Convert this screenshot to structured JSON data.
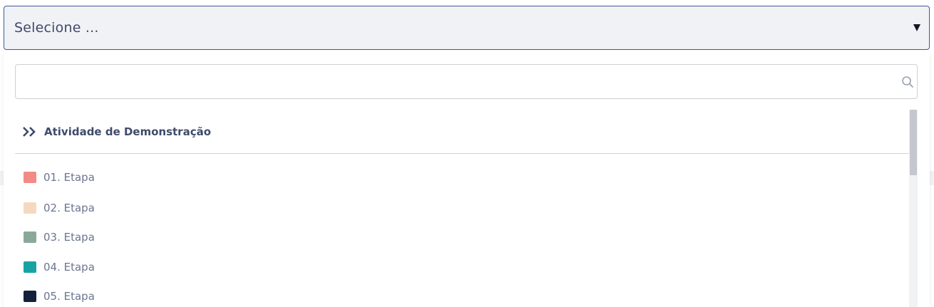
{
  "select": {
    "placeholder": "Selecione ..."
  },
  "search": {
    "value": "",
    "placeholder": ""
  },
  "group": {
    "label": "Atividade de Demonstração"
  },
  "options": [
    {
      "label": "01. Etapa",
      "color": "#f28b86"
    },
    {
      "label": "02. Etapa",
      "color": "#f5d9bf"
    },
    {
      "label": "03. Etapa",
      "color": "#8aa99a"
    },
    {
      "label": "04. Etapa",
      "color": "#17a3a3"
    },
    {
      "label": "05. Etapa",
      "color": "#14213a"
    }
  ],
  "colors": {
    "accent": "#3d5a99",
    "text_dark": "#3f4a6b",
    "text_muted": "#6b7591"
  }
}
